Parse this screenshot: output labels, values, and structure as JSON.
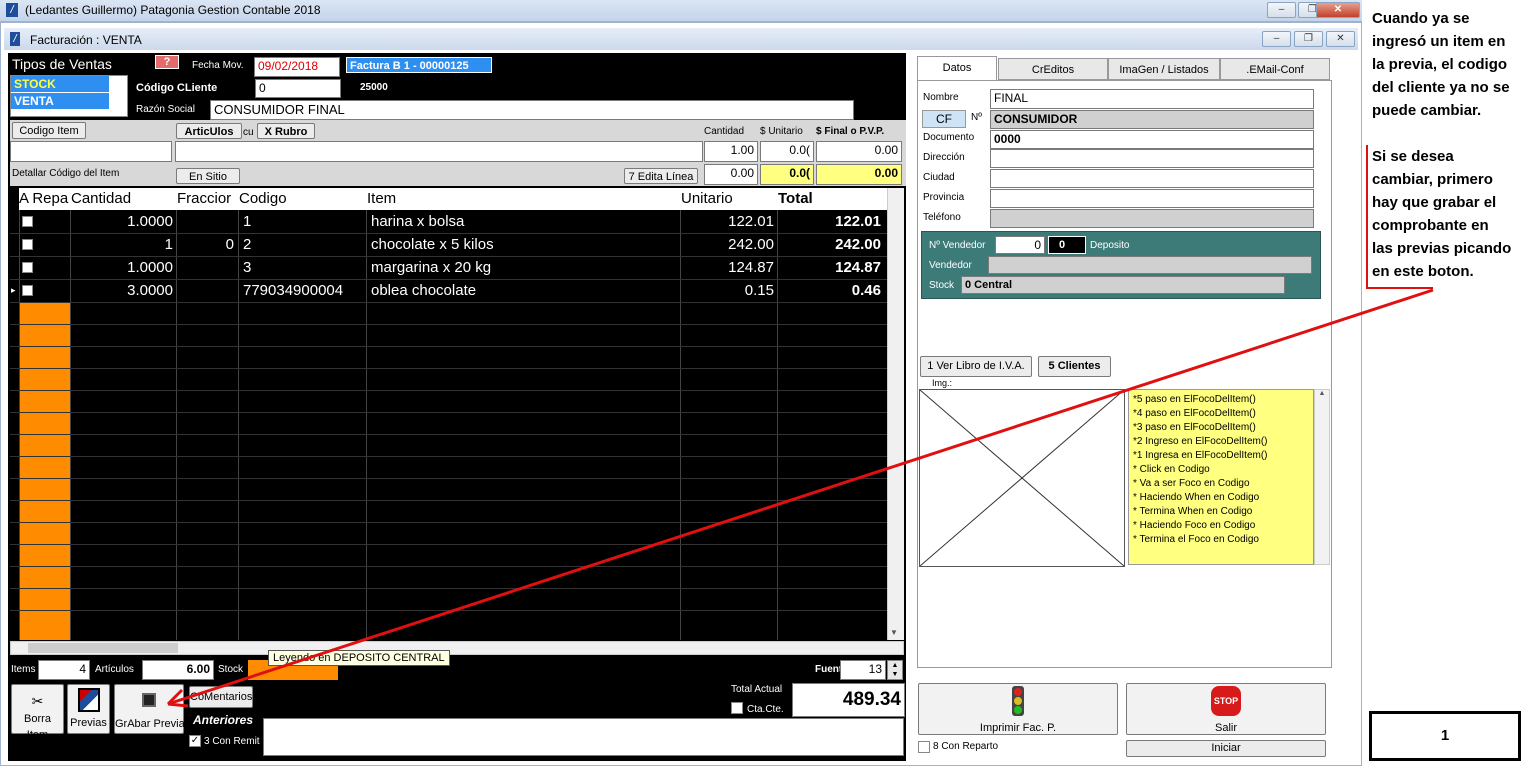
{
  "app": {
    "title": "(Ledantes Guillermo) Patagonia Gestion Contable 2018"
  },
  "child": {
    "title": "Facturación : VENTA"
  },
  "ventas": {
    "label": "Tipos de Ventas",
    "items": [
      "STOCK",
      "VENTA"
    ]
  },
  "fecha": {
    "label": "Fecha Mov.",
    "value": "09/02/2018"
  },
  "factura": "Factura  B    1 - 00000125",
  "cliente": {
    "code_label": "Código CLiente",
    "code": "0",
    "number": "25000",
    "razon_label": "Razón Social",
    "razon": "CONSUMIDOR FINAL"
  },
  "entry": {
    "codigo_btn": "Codigo Item",
    "articulos_btn": "ArticUlos",
    "rubro_btn": "X Rubro",
    "cu": "cu",
    "cantidad_label": "Cantidad",
    "unitario_label": "$ Unitario",
    "final_label": "$ Final o P.V.P.",
    "cantidad": "1.00",
    "unitario": "0.0(",
    "final": "0.00",
    "cantidad2": "0.00",
    "unitario2": "0.0(",
    "final2": "0.00",
    "detallar": "Detallar Código del Item",
    "sitio_btn": "En Sitio Web",
    "edita_btn": "7 Edita Línea"
  },
  "grid": {
    "headers": [
      "A Repa",
      "Cantidad",
      "Fraccior",
      "Codigo",
      "Item",
      "Unitario",
      "Total"
    ],
    "rows": [
      {
        "cantidad": "1.0000",
        "fraccion": "",
        "codigo": "1",
        "item": "harina x bolsa",
        "unitario": "122.01",
        "total": "122.01"
      },
      {
        "cantidad": "1",
        "fraccion": "0",
        "codigo": "2",
        "item": "chocolate x 5 kilos",
        "unitario": "242.00",
        "total": "242.00"
      },
      {
        "cantidad": "1.0000",
        "fraccion": "",
        "codigo": "3",
        "item": "margarina x 20 kg",
        "unitario": "124.87",
        "total": "124.87"
      },
      {
        "cantidad": "3.0000",
        "fraccion": "",
        "codigo": "779034900004",
        "item": "oblea chocolate",
        "unitario": "0.15",
        "total": "0.46"
      }
    ]
  },
  "bottom": {
    "items_label": "Items",
    "items": "4",
    "articulos_label": "Artículos",
    "articulos": "6.00",
    "stock_label": "Stock",
    "tooltip": "Leyendo en DEPOSITO CENTRAL",
    "fuente_label": "Fuente",
    "fuente": "13",
    "total_label": "Total Actual",
    "total": "489.34",
    "ctacte": "Cta.Cte.",
    "borra": "Borra Item",
    "previas": "Previas",
    "grabar": "GrAbar Previa",
    "comentarios": "CoMentarios",
    "anteriores": "Anteriores",
    "con_remit": "3 Con Remit"
  },
  "tabs": [
    "Datos",
    "CrEditos",
    "ImaGen / Listados",
    ".EMail-Conf"
  ],
  "datos": {
    "nombre_label": "Nombre",
    "nombre": "FINAL",
    "cf": "CF",
    "no_label": "Nº",
    "cf_value": "CONSUMIDOR",
    "documento_label": "Documento",
    "documento": "0000",
    "direccion_label": "Dirección",
    "ciudad_label": "Ciudad",
    "provincia_label": "Provincia",
    "telefono_label": "Teléfono"
  },
  "vendedor": {
    "label": "Nº Vendedor",
    "num": "0",
    "dep_num": "0",
    "deposito_label": "Deposito",
    "vendedor_label": "Vendedor",
    "stock_label": "Stock",
    "stock": "0  Central"
  },
  "right_btns": {
    "iva": "1 Ver Libro de I.V.A.",
    "clientes": "5 Clientes",
    "img_label": "Img.:"
  },
  "log": [
    "*5 paso en ElFocoDelItem()",
    "*4 paso en ElFocoDelItem()",
    "*3 paso en ElFocoDelItem()",
    "*2 Ingreso en ElFocoDelItem()",
    "*1 Ingresa en ElFocoDelItem()",
    "* Click en Codigo",
    "* Va a ser Foco en Codigo",
    "* Haciendo When en Codigo",
    "* Termina When en Codigo",
    "* Haciendo Foco en Codigo",
    "* Termina el Foco en Codigo"
  ],
  "actions": {
    "imprimir": "Imprimir Fac. P.",
    "salir": "Salir",
    "stop": "STOP",
    "reparto": "8 Con Reparto",
    "iniciar": "Iniciar"
  },
  "notes": {
    "p1": [
      "Cuando ya se",
      "ingresó un item en",
      "la previa, el codigo",
      "del cliente ya no se",
      "puede cambiar."
    ],
    "p2": [
      "Si se desea",
      "cambiar, primero",
      "hay que grabar el",
      "comprobante en",
      "las previas picando",
      "en este boton."
    ],
    "box": "1"
  },
  "colors": {
    "accent": "#ff8c00",
    "annotation": "#e01010"
  }
}
